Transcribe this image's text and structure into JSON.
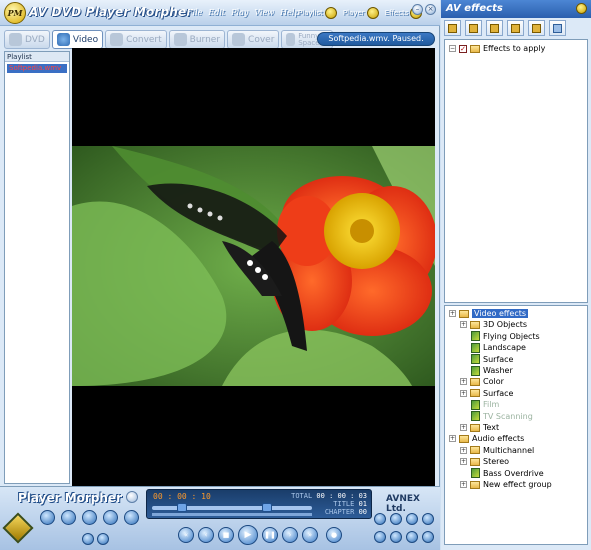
{
  "app": {
    "title": "AV DVD Player Morpher",
    "logo_text": "PM",
    "menu": [
      "File",
      "Edit",
      "Play",
      "View",
      "Help"
    ],
    "panel_toggles": [
      "Playlist",
      "Player",
      "Effects"
    ]
  },
  "tabs": [
    {
      "label": "DVD",
      "active": false
    },
    {
      "label": "Video",
      "active": true
    },
    {
      "label": "Convert",
      "active": false
    },
    {
      "label": "Burner",
      "active": false
    },
    {
      "label": "Cover",
      "active": false
    },
    {
      "label": "Funny Space",
      "active": false
    }
  ],
  "status_text": "Softpedia.wmv. Paused.",
  "playlist": {
    "header": "Playlist",
    "items": [
      "Softpedia.wmv"
    ]
  },
  "controls": {
    "brand": "Player Morpher",
    "vendor": "AVNEX Ltd.",
    "time_elapsed": "00 : 00 : 10",
    "total_label": "TOTAL",
    "total_time": "00 : 00 : 03",
    "title_label": "TITLE",
    "title_value": "01",
    "chapter_label": "CHAPTER",
    "chapter_value": "00"
  },
  "effects_panel": {
    "title": "AV effects",
    "applied_root": "Effects to apply",
    "tree": [
      {
        "label": "Video effects",
        "level": 0,
        "type": "folder",
        "selected": true
      },
      {
        "label": "3D Objects",
        "level": 1,
        "type": "folder"
      },
      {
        "label": "Flying Objects",
        "level": 2,
        "type": "effect"
      },
      {
        "label": "Landscape",
        "level": 2,
        "type": "effect"
      },
      {
        "label": "Surface",
        "level": 2,
        "type": "effect"
      },
      {
        "label": "Washer",
        "level": 2,
        "type": "effect"
      },
      {
        "label": "Color",
        "level": 1,
        "type": "folder"
      },
      {
        "label": "Surface",
        "level": 1,
        "type": "folder"
      },
      {
        "label": "Film",
        "level": 2,
        "type": "effect",
        "dim": true
      },
      {
        "label": "TV Scanning",
        "level": 2,
        "type": "effect",
        "dim": true
      },
      {
        "label": "Text",
        "level": 1,
        "type": "folder"
      },
      {
        "label": "Audio effects",
        "level": 0,
        "type": "folder"
      },
      {
        "label": "Multichannel",
        "level": 1,
        "type": "folder"
      },
      {
        "label": "Stereo",
        "level": 1,
        "type": "folder"
      },
      {
        "label": "Bass Overdrive",
        "level": 2,
        "type": "effect"
      },
      {
        "label": "New effect group",
        "level": 1,
        "type": "folder"
      }
    ]
  },
  "colors": {
    "accent": "#316ac5",
    "title_blue": "#2a5fae",
    "status_bg": "#205a9e",
    "lcd_time": "#ff9a2a"
  }
}
